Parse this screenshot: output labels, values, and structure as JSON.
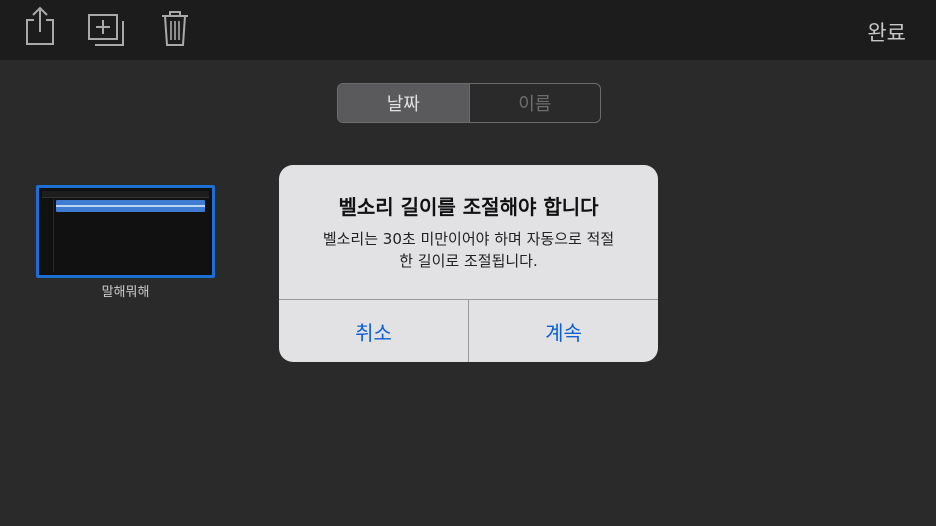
{
  "toolbar": {
    "icons": [
      "share-icon",
      "add-copy-icon",
      "trash-icon"
    ],
    "done_label": "완료"
  },
  "sort": {
    "options": [
      "날짜",
      "이름"
    ],
    "selected": "날짜"
  },
  "project": {
    "name": "말해뭐해"
  },
  "alert": {
    "title": "벨소리 길이를 조절해야 합니다",
    "message_line1": "벨소리는 30초 미만이어야 하며 자동으로 적절",
    "message_line2": "한 길이로 조절됩니다.",
    "cancel_label": "취소",
    "continue_label": "계속",
    "button_color": "#0a5fd6"
  },
  "colors": {
    "background": "#2b2a2b",
    "toolbar": "#1c1c1d",
    "selection_border": "#1e6fd3"
  }
}
